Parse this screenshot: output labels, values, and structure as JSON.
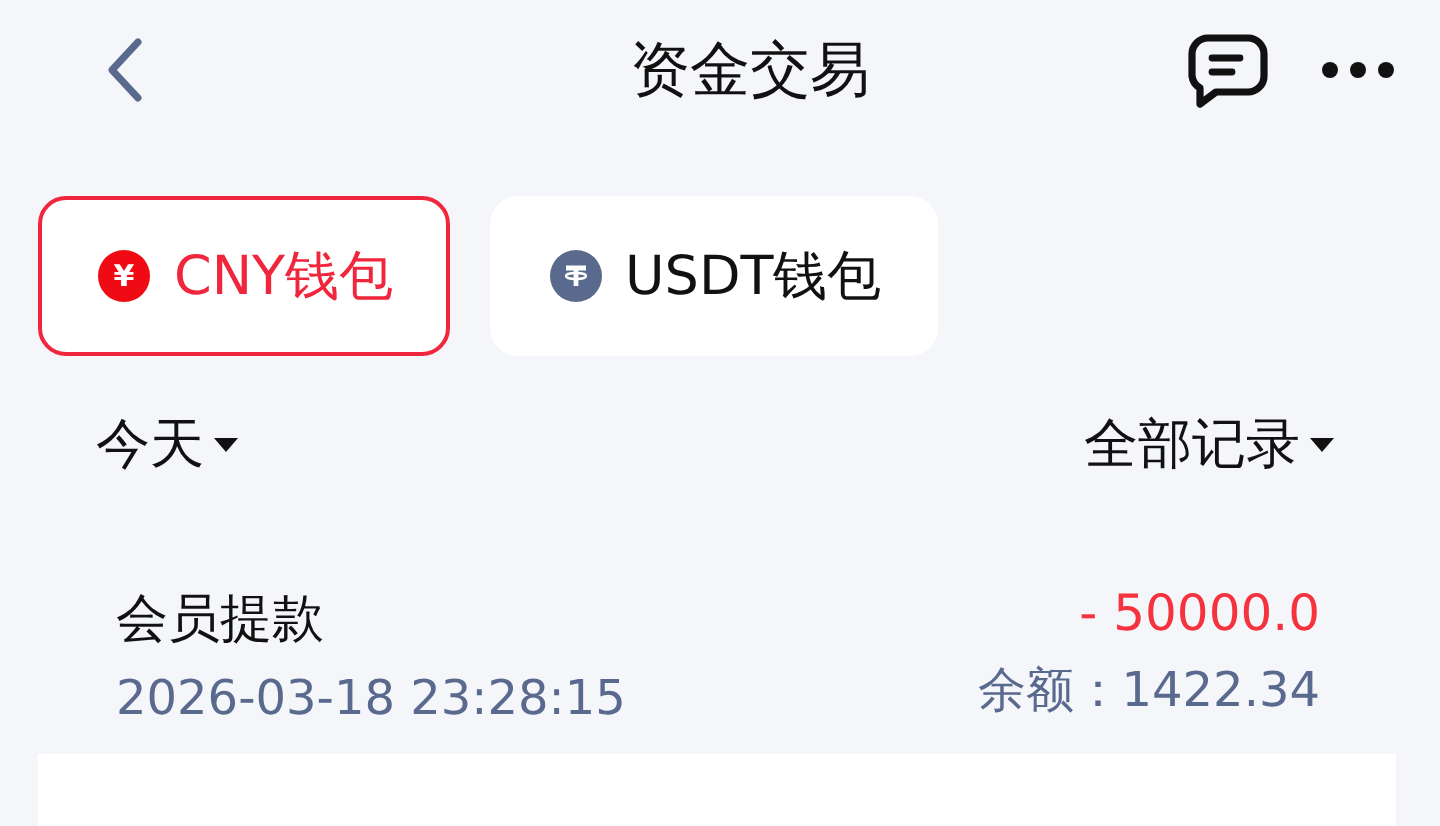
{
  "header": {
    "title": "资金交易"
  },
  "wallet_tabs": [
    {
      "label": "CNY钱包",
      "symbol": "¥",
      "kind": "cny",
      "selected": true
    },
    {
      "label": "USDT钱包",
      "kind": "usdt",
      "selected": false
    }
  ],
  "filters": {
    "date": "今天",
    "type": "全部记录"
  },
  "records": [
    {
      "title": "会员提款",
      "time": "2026-03-18 23:28:15",
      "amount": "- 50000.0",
      "kind": "debit",
      "balance_label": "余额：",
      "balance": "1422.34"
    }
  ]
}
